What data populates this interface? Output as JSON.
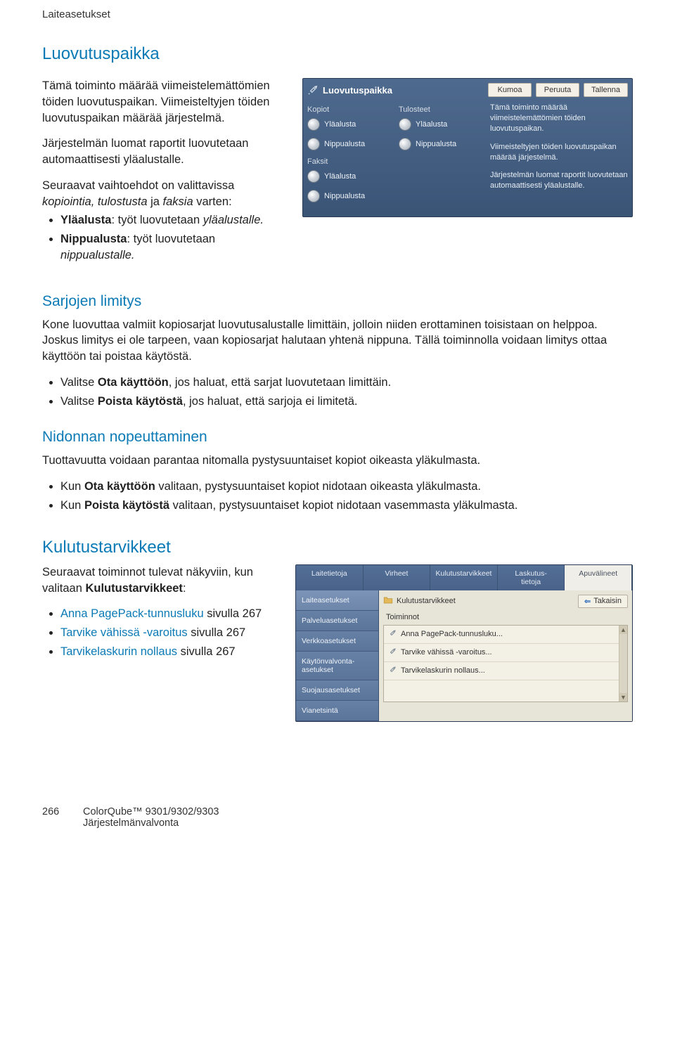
{
  "header": {
    "title": "Laiteasetukset"
  },
  "section1": {
    "heading": "Luovutuspaikka",
    "p1": "Tämä toiminto määrää viimeistelemättömien töiden luovutuspaikan. Viimeisteltyjen töiden luovutuspaikan määrää järjestelmä.",
    "p2": "Järjestelmän luomat raportit luovutetaan automaattisesti yläalustalle.",
    "options_intro_a": "Seuraavat vaihtoehdot on valittavissa ",
    "options_intro_b": "kopiointia, tulostusta",
    "options_intro_c": " ja ",
    "options_intro_d": "faksia",
    "options_intro_e": " varten:",
    "bullets": [
      {
        "bold": "Yläalusta",
        "rest": ": työt luovutetaan ",
        "ital": "yläalustalle."
      },
      {
        "bold": "Nippualusta",
        "rest": ": työt luovutetaan ",
        "ital": "nippualustalle."
      }
    ]
  },
  "panel1": {
    "title": "Luovutuspaikka",
    "buttons": {
      "undo": "Kumoa",
      "cancel": "Peruuta",
      "save": "Tallenna"
    },
    "cols": {
      "copies": {
        "label": "Kopiot",
        "items": [
          "Yläalusta",
          "Nippualusta"
        ]
      },
      "prints": {
        "label": "Tulosteet",
        "items": [
          "Yläalusta",
          "Nippualusta"
        ]
      },
      "faxes": {
        "label": "Faksit",
        "items": [
          "Yläalusta",
          "Nippualusta"
        ]
      }
    },
    "info": [
      "Tämä toiminto määrää viimeistelemättömien töiden luovutuspaikan.",
      "Viimeisteltyjen töiden luovutuspaikan määrää järjestelmä.",
      "Järjestelmän luomat raportit luovutetaan automaattisesti yläalustalle."
    ]
  },
  "section2": {
    "heading": "Sarjojen limitys",
    "p1": "Kone luovuttaa valmiit kopiosarjat luovutusalustalle limittäin, jolloin niiden erottaminen toisistaan on helppoa. Joskus limitys ei ole tarpeen, vaan kopiosarjat halutaan yhtenä nippuna. Tällä toiminnolla voidaan limitys ottaa käyttöön tai poistaa käytöstä.",
    "bullets": [
      {
        "pre": "Valitse ",
        "bold": "Ota käyttöön",
        "rest": ", jos haluat, että sarjat luovutetaan limittäin."
      },
      {
        "pre": "Valitse ",
        "bold": "Poista käytöstä",
        "rest": ", jos haluat, että sarjoja ei limitetä."
      }
    ]
  },
  "section3": {
    "heading": "Nidonnan nopeuttaminen",
    "p1": "Tuottavuutta voidaan parantaa nitomalla pystysuuntaiset kopiot oikeasta yläkulmasta.",
    "bullets": [
      {
        "pre": "Kun ",
        "bold": "Ota käyttöön",
        "rest": " valitaan, pystysuuntaiset kopiot nidotaan oikeasta yläkulmasta."
      },
      {
        "pre": "Kun ",
        "bold": "Poista käytöstä",
        "rest": " valitaan, pystysuuntaiset kopiot nidotaan vasemmasta yläkulmasta."
      }
    ]
  },
  "section4": {
    "heading": "Kulutustarvikkeet",
    "intro_a": "Seuraavat toiminnot tulevat näkyviin, kun valitaan ",
    "intro_b": "Kulutustarvikkeet",
    "intro_c": ":",
    "links": [
      {
        "link": "Anna PagePack-tunnusluku",
        "rest": " sivulla 267"
      },
      {
        "link": "Tarvike vähissä -varoitus",
        "rest": " sivulla 267"
      },
      {
        "link": "Tarvikelaskurin nollaus",
        "rest": " sivulla 267"
      }
    ]
  },
  "panel2": {
    "tabs": [
      "Laitetietoja",
      "Virheet",
      "Kulutustarvikkeet",
      "Laskutus-\ntietoja",
      "Apuvälineet"
    ],
    "active_tab_idx": 4,
    "side": [
      "Laiteasetukset",
      "Palveluasetukset",
      "Verkkoasetukset",
      "Käytönvalvonta-asetukset",
      "Suojausasetukset",
      "Vianetsintä"
    ],
    "side_sel_idx": 0,
    "folder_label": "Kulutustarvikkeet",
    "back_label": "Takaisin",
    "list_header": "Toiminnot",
    "items": [
      "Anna PagePack-tunnusluku...",
      "Tarvike vähissä -varoitus...",
      "Tarvikelaskurin nollaus..."
    ]
  },
  "footer": {
    "page": "266",
    "product": "ColorQube™ 9301/9302/9303",
    "sub": "Järjestelmänvalvonta"
  }
}
